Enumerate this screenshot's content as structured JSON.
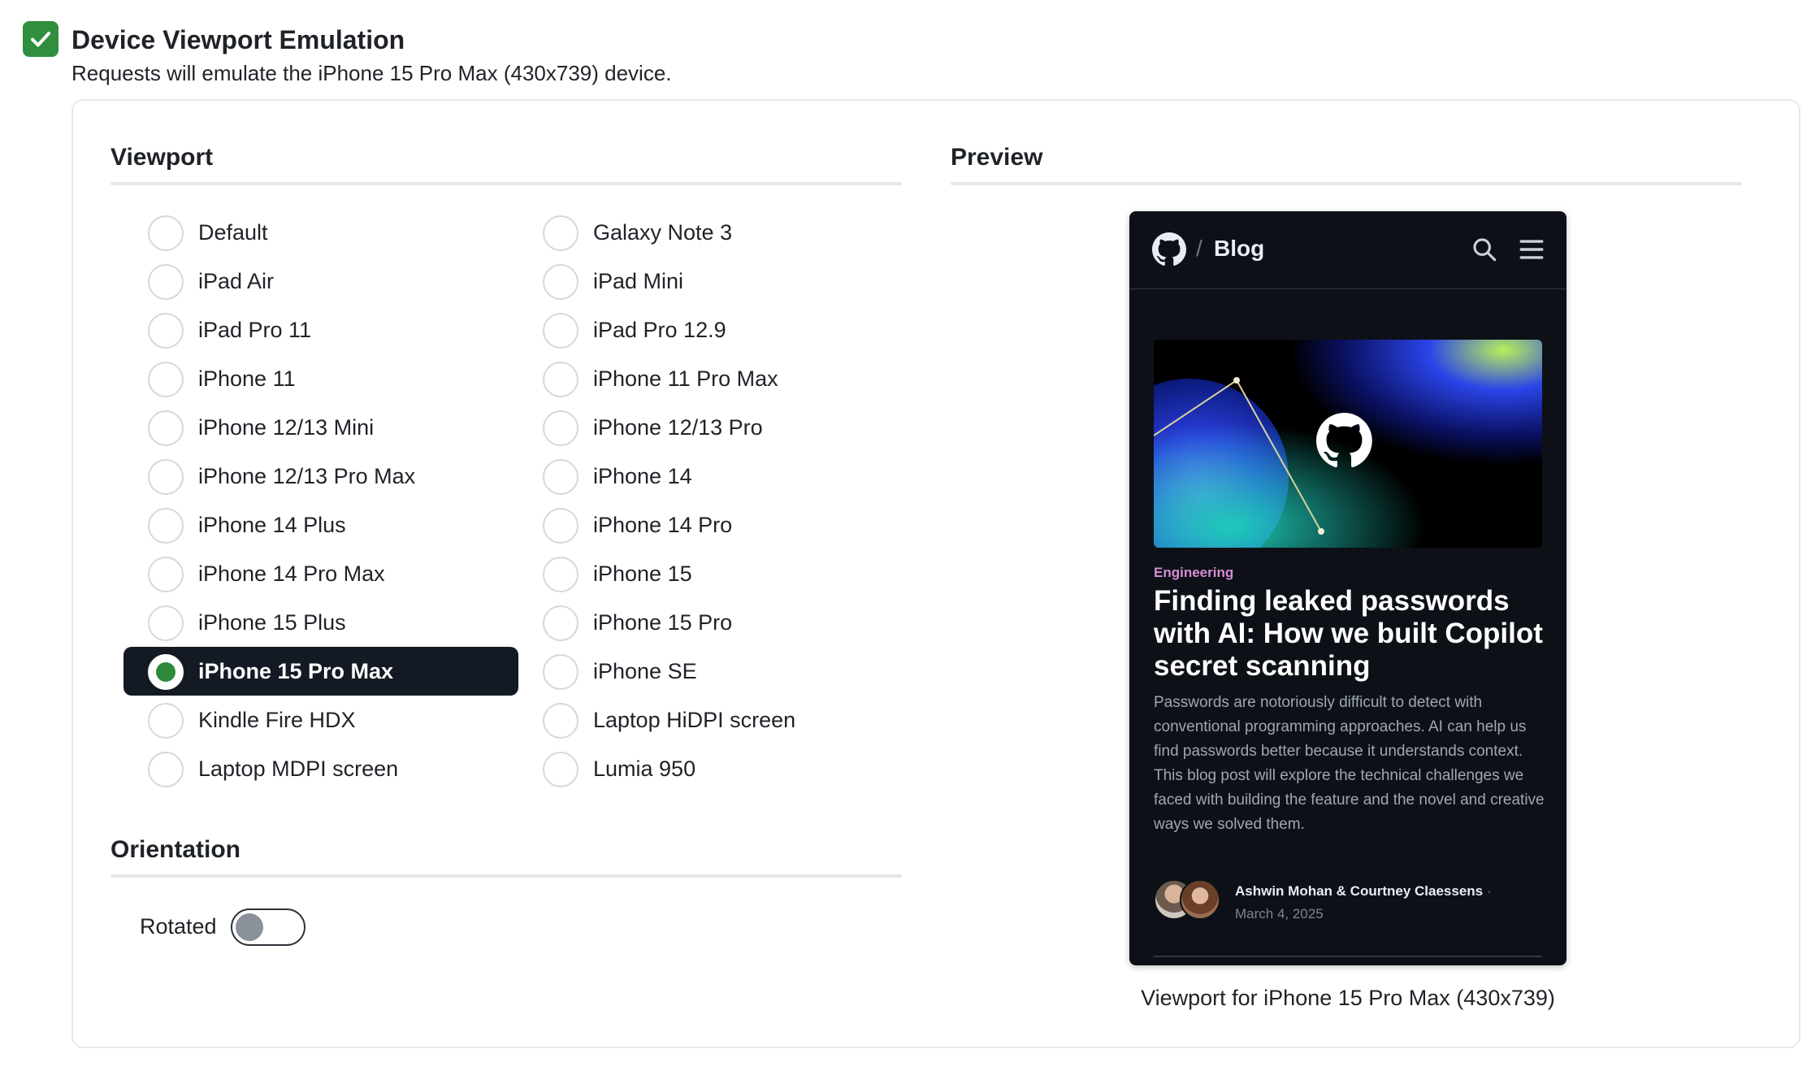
{
  "header": {
    "title": "Device Viewport Emulation",
    "subtitle": "Requests will emulate the iPhone 15 Pro Max (430x739) device.",
    "enabled": true
  },
  "viewport": {
    "section_title": "Viewport",
    "selected": "iPhone 15 Pro Max",
    "options": [
      "Default",
      "Galaxy Note 3",
      "iPad Air",
      "iPad Mini",
      "iPad Pro 11",
      "iPad Pro 12.9",
      "iPhone 11",
      "iPhone 11 Pro Max",
      "iPhone 12/13 Mini",
      "iPhone 12/13 Pro",
      "iPhone 12/13 Pro Max",
      "iPhone 14",
      "iPhone 14 Plus",
      "iPhone 14 Pro",
      "iPhone 14 Pro Max",
      "iPhone 15",
      "iPhone 15 Plus",
      "iPhone 15 Pro",
      "iPhone 15 Pro Max",
      "iPhone SE",
      "Kindle Fire HDX",
      "Laptop HiDPI screen",
      "Laptop MDPI screen",
      "Lumia 950"
    ]
  },
  "orientation": {
    "section_title": "Orientation",
    "rotated_label": "Rotated",
    "rotated": false
  },
  "preview": {
    "section_title": "Preview",
    "caption": "Viewport for iPhone 15 Pro Max (430x739)",
    "site": {
      "nav_slash": "/",
      "nav_title": "Blog",
      "tag": "Engineering",
      "post_title": "Finding leaked passwords with AI: How we built Copilot secret scanning",
      "post_body": "Passwords are notoriously difficult to detect with conventional programming approaches. AI can help us find passwords better because it understands context. This blog post will explore the technical challenges we faced with building the feature and the novel and creative ways we solved them.",
      "authors": "Ashwin Mohan & Courtney Claessens",
      "author_separator": "·",
      "date": "March 4, 2025"
    }
  },
  "colors": {
    "accent_green": "#2f8f3e",
    "selected_bg": "#141a24",
    "phone_bg": "#0d1117"
  }
}
